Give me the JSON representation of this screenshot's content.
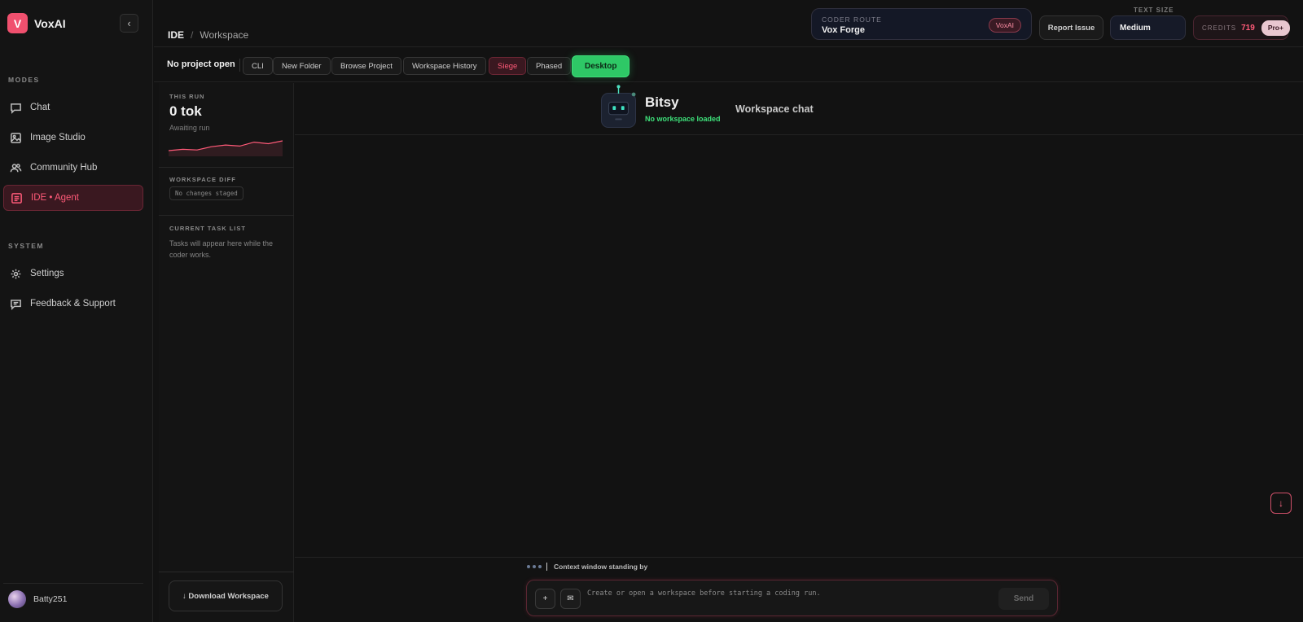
{
  "app": {
    "logo_letter": "V",
    "name": "VoxAI",
    "collapse_glyph": "‹"
  },
  "sidebar": {
    "modes_label": "MODES",
    "modes": [
      {
        "label": "Chat",
        "icon": "chat-icon"
      },
      {
        "label": "Image Studio",
        "icon": "image-icon"
      },
      {
        "label": "Community Hub",
        "icon": "users-icon"
      },
      {
        "label": "IDE • Agent",
        "icon": "code-icon",
        "active": true
      }
    ],
    "system_label": "SYSTEM",
    "system": [
      {
        "label": "Settings",
        "icon": "gear-icon"
      },
      {
        "label": "Feedback & Support",
        "icon": "feedback-icon"
      }
    ],
    "user": {
      "name": "Batty251"
    }
  },
  "header": {
    "breadcrumb": {
      "root": "IDE",
      "sep": "/",
      "current": "Workspace"
    },
    "route": {
      "label": "CODER ROUTE",
      "value": "Vox Forge",
      "badge": "VoxAI"
    },
    "report_label": "Report Issue",
    "text_size": {
      "label": "TEXT SIZE",
      "value": "Medium"
    },
    "credits": {
      "label": "CREDITS",
      "value": "719",
      "plan": "Pro+"
    }
  },
  "toolbar": {
    "project_status": "No project open",
    "buttons": [
      "CLI",
      "New Folder",
      "Browse Project",
      "Workspace History",
      "Siege",
      "Phased",
      "Desktop"
    ]
  },
  "left_panel": {
    "run_label": "THIS RUN",
    "tokens": "0 tok",
    "run_status": "Awaiting run",
    "sparkline": [
      0.25,
      0.35,
      0.3,
      0.55,
      0.68,
      0.6,
      0.9,
      0.78,
      1.0
    ],
    "diff_label": "WORKSPACE DIFF",
    "diff_status": "No changes staged",
    "tasks_label": "CURRENT TASK LIST",
    "tasks_placeholder": "Tasks will appear here while the coder works.",
    "download_label": "↓ Download Workspace"
  },
  "chat": {
    "bot_name": "Bitsy",
    "bot_status": "No workspace loaded",
    "title": "Workspace chat",
    "context_status": "Context window standing by",
    "input_placeholder": "Create or open a workspace before starting a coding run.",
    "send_label": "Send",
    "add_glyph": "+",
    "mail_glyph": "✉",
    "scroll_glyph": "↓"
  },
  "colors": {
    "accent": "#ff5a78",
    "success": "#2ec866",
    "background": "#121212"
  }
}
